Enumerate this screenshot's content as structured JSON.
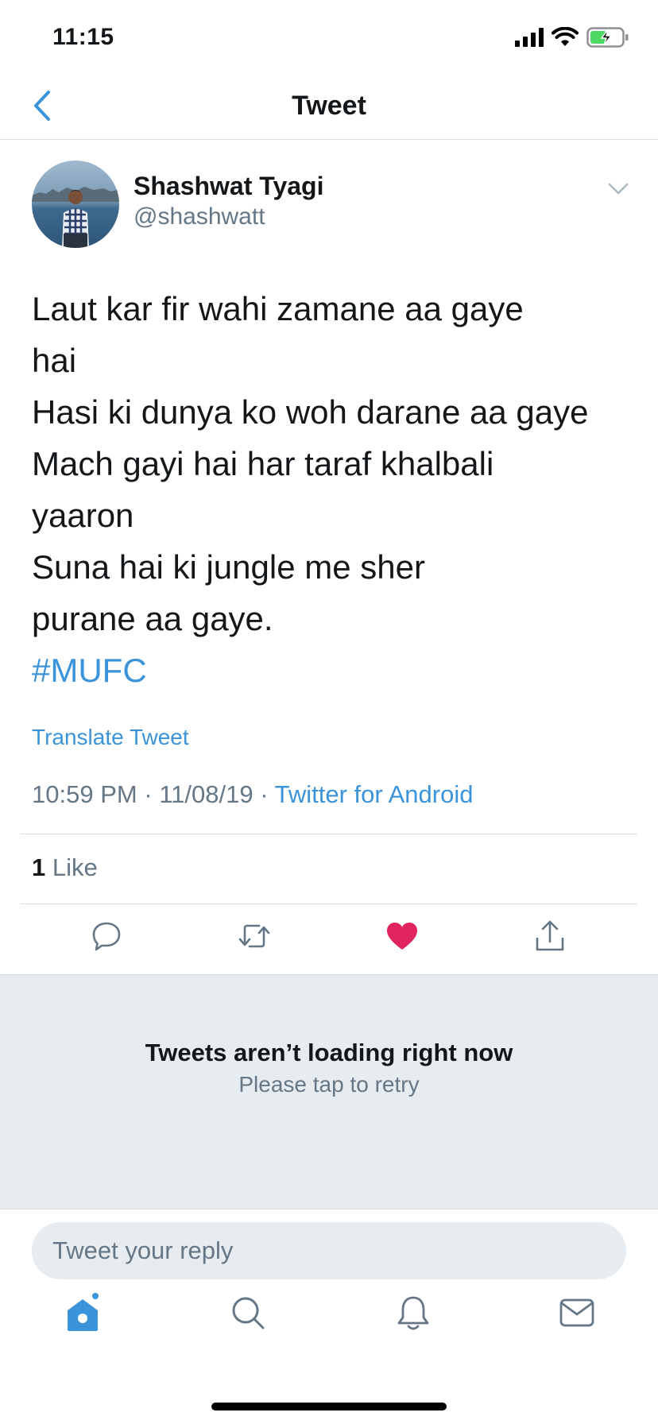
{
  "status_bar": {
    "time": "11:15",
    "icons": [
      "signal-icon",
      "wifi-icon",
      "battery-charging-icon"
    ]
  },
  "nav": {
    "back_icon": "chevron-left-icon",
    "title": "Tweet"
  },
  "tweet": {
    "author": {
      "name": "Shashwat Tyagi",
      "handle": "@shashwatt"
    },
    "menu_icon": "chevron-down-icon",
    "lines": [
      "Laut kar fir wahi zamane aa gaye",
      "hai",
      "Hasi ki dunya ko woh darane aa gaye",
      "Mach gayi hai har taraf khalbali",
      "yaaron",
      "Suna hai ki jungle me sher",
      "purane aa gaye."
    ],
    "hashtag": "#MUFC",
    "translate_label": "Translate Tweet",
    "timestamp": "10:59 PM · 11/08/19 · ",
    "source": "Twitter for Android",
    "likes_count": "1",
    "likes_label": " Like"
  },
  "actions": {
    "reply_icon": "reply-icon",
    "retweet_icon": "retweet-icon",
    "like_icon": "heart-icon",
    "share_icon": "share-icon",
    "liked": true
  },
  "error": {
    "title": "Tweets aren’t loading right now",
    "subtitle": "Please tap to retry"
  },
  "reply": {
    "placeholder": "Tweet your reply"
  },
  "tab_bar": {
    "items": [
      "home-icon",
      "search-icon",
      "notifications-icon",
      "messages-icon"
    ],
    "active": "home-icon"
  },
  "colors": {
    "accent": "#3b94d9",
    "like": "#e0245e",
    "secondary_text": "#657786",
    "panel_bg": "#e6ecf0"
  }
}
